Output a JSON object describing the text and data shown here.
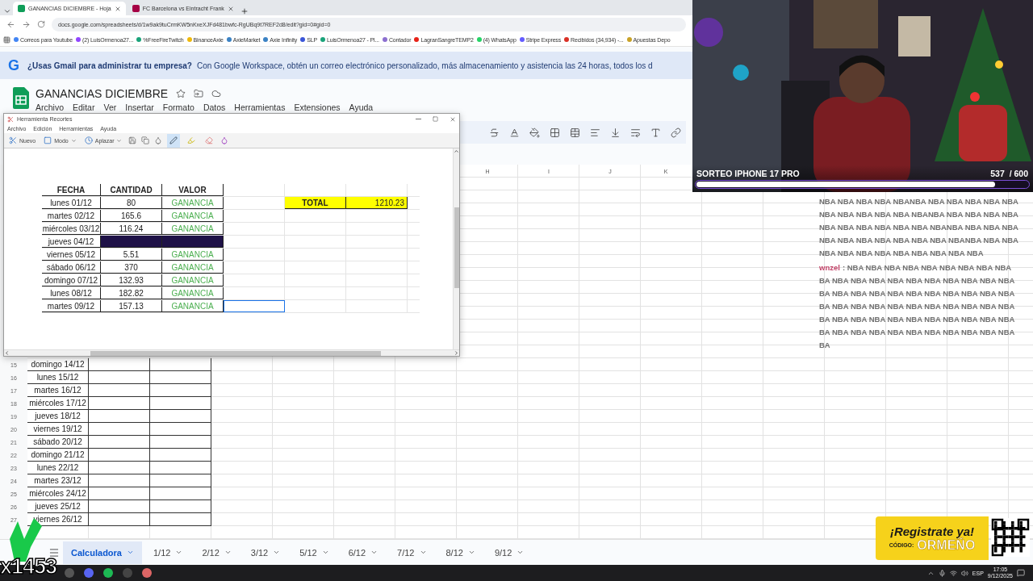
{
  "browser": {
    "tabs": [
      {
        "title": "GANANCIAS DICIEMBRE - Hoja",
        "selected": true,
        "kind": "sheets"
      },
      {
        "title": "FC Barcelona vs Eintracht Frank",
        "selected": false,
        "kind": "sport"
      }
    ],
    "url": "docs.google.com/spreadsheets/d/1w9ak9tuCrmKW5nKxeXJFd481bwfc-RgUBq9t7REF2d8/edit?gid=0#gid=0",
    "bookmarks": [
      {
        "label": "Correos para Youtube",
        "color": "#4285f4"
      },
      {
        "label": "(2) LuisOrmenoa27...",
        "color": "#9146ff"
      },
      {
        "label": "%FreeFireTwitch",
        "color": "#1aa37a"
      },
      {
        "label": "BinanceAxie",
        "color": "#f0b90b"
      },
      {
        "label": "AxieMarket",
        "color": "#3b82c4"
      },
      {
        "label": "Axie Infinity",
        "color": "#3b82c4"
      },
      {
        "label": "SLP",
        "color": "#3a55d8"
      },
      {
        "label": "LuisOrmenoa27 - Pl...",
        "color": "#1aa37a"
      },
      {
        "label": "Contador",
        "color": "#8c6fd0"
      },
      {
        "label": "LagranSangreTEMP2",
        "color": "#e62117"
      },
      {
        "label": "(4) WhatsApp",
        "color": "#25d366"
      },
      {
        "label": "Stripe Express",
        "color": "#635bff"
      },
      {
        "label": "Recibidos (34,934) -...",
        "color": "#d93025"
      },
      {
        "label": "Apuestas Depo",
        "color": "#c9a227"
      }
    ]
  },
  "banner": {
    "logo": "G",
    "question": "¿Usas Gmail para administrar tu empresa?",
    "text": "Con Google Workspace, obtén un correo electrónico personalizado, más almacenamiento y asistencia las 24 horas, todos los d"
  },
  "doc": {
    "title": "GANANCIAS DICIEMBRE",
    "menu": [
      "Archivo",
      "Editar",
      "Ver",
      "Insertar",
      "Formato",
      "Datos",
      "Herramientas",
      "Extensiones",
      "Ayuda"
    ]
  },
  "sheet": {
    "columns": [
      "H",
      "I",
      "J",
      "K"
    ],
    "rows": [
      {
        "number": "15",
        "date": "domingo 14/12"
      },
      {
        "number": "16",
        "date": "lunes 15/12"
      },
      {
        "number": "17",
        "date": "martes 16/12"
      },
      {
        "number": "18",
        "date": "miércoles 17/12"
      },
      {
        "number": "19",
        "date": "jueves 18/12"
      },
      {
        "number": "20",
        "date": "viernes 19/12"
      },
      {
        "number": "21",
        "date": "sábado 20/12"
      },
      {
        "number": "22",
        "date": "domingo 21/12"
      },
      {
        "number": "23",
        "date": "lunes 22/12"
      },
      {
        "number": "24",
        "date": "martes 23/12"
      },
      {
        "number": "25",
        "date": "miércoles 24/12"
      },
      {
        "number": "26",
        "date": "jueves 25/12"
      },
      {
        "number": "27",
        "date": "viernes 26/12"
      }
    ]
  },
  "sheet_tabs": [
    {
      "label": "Calculadora",
      "selected": true
    },
    {
      "label": "1/12",
      "selected": false
    },
    {
      "label": "2/12",
      "selected": false
    },
    {
      "label": "3/12",
      "selected": false
    },
    {
      "label": "5/12",
      "selected": false
    },
    {
      "label": "6/12",
      "selected": false
    },
    {
      "label": "7/12",
      "selected": false
    },
    {
      "label": "8/12",
      "selected": false
    },
    {
      "label": "9/12",
      "selected": false
    }
  ],
  "snip": {
    "title": "Herramienta Recortes",
    "menu": [
      "Archivo",
      "Edición",
      "Herramientas",
      "Ayuda"
    ],
    "tools": [
      {
        "label": "Nuevo",
        "kind": "new"
      },
      {
        "label": "Modo",
        "kind": "mode"
      },
      {
        "label": "Aplazar",
        "kind": "delay"
      }
    ],
    "pens": [
      {
        "kind": "pen",
        "selected": true
      },
      {
        "kind": "highlighter",
        "selected": false
      },
      {
        "kind": "eraser",
        "selected": false
      }
    ],
    "table": {
      "headers": [
        "FECHA",
        "CANTIDAD",
        "VALOR"
      ],
      "rows": [
        {
          "date": "lunes 01/12",
          "amount": "80",
          "status": "GANANCIA",
          "blocked": false
        },
        {
          "date": "martes 02/12",
          "amount": "165.6",
          "status": "GANANCIA",
          "blocked": false
        },
        {
          "date": "miércoles 03/12",
          "amount": "116.24",
          "status": "GANANCIA",
          "blocked": false
        },
        {
          "date": "jueves 04/12",
          "blocked": true
        },
        {
          "date": "viernes 05/12",
          "amount": "5.51",
          "status": "GANANCIA",
          "blocked": false
        },
        {
          "date": "sábado 06/12",
          "amount": "370",
          "status": "GANANCIA",
          "blocked": false
        },
        {
          "date": "domingo 07/12",
          "amount": "132.93",
          "status": "GANANCIA",
          "blocked": false
        },
        {
          "date": "lunes 08/12",
          "amount": "182.82",
          "status": "GANANCIA",
          "blocked": false
        },
        {
          "date": "martes 09/12",
          "amount": "157.13",
          "status": "GANANCIA",
          "blocked": false
        }
      ],
      "total_label": "TOTAL",
      "total_value": "1210.23"
    }
  },
  "stream": {
    "goal_title": "SORTEO IPHONE 17 PRO",
    "count": "537",
    "target": "/ 600",
    "level": 0.9,
    "chat": [
      {
        "lines": [
          "NBA NBA NBA NBA NBANBA NBA NBA NBA NBA NBA",
          "NBA NBA NBA NBA NBA NBANBA NBA NBA NBA NBA",
          "NBA NBA NBA NBA NBA NBA NBANBA NBA NBA NBA",
          "NBA NBA NBA NBA NBA NBA NBA NBANBA NBA NBA",
          "NBA NBA NBA NBA NBA NBA NBA NBA NBA"
        ]
      },
      {
        "user": "wnzel",
        "lines": [
          ": NBA NBA NBA NBA NBA NBA NBA NBA NBA",
          "BA NBA NBA NBA NBA NBA NBA NBA NBA NBA NBA",
          "BA NBA NBA NBA NBA NBA NBA NBA NBA NBA NBA",
          "BA NBA NBA NBA NBA NBA NBA NBA NBA NBA NBA",
          "BA NBA NBA NBA NBA NBA NBA NBA NBA NBA NBA",
          "BA NBA NBA NBA NBA NBA NBA NBA NBA NBA NBA",
          "BA"
        ]
      }
    ],
    "counter": "x1453",
    "promo": {
      "headline": "¡Registrate ya!",
      "code_label": "CÓDIGO:",
      "code": "ORMEÑO"
    }
  },
  "taskbar": {
    "language": "ESP",
    "time": "17:05",
    "date": "9/12/2025"
  }
}
